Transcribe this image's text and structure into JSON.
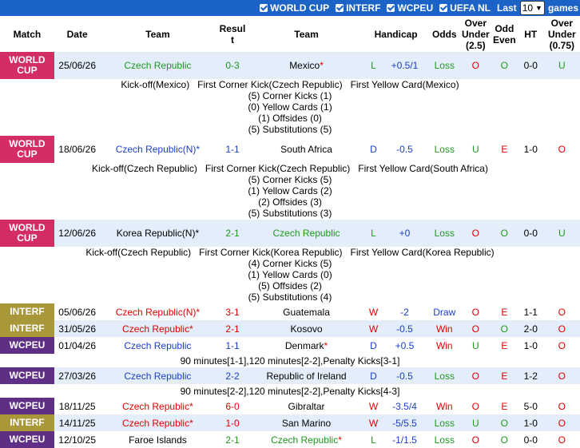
{
  "filters": [
    {
      "label": "WORLD CUP",
      "checked": true
    },
    {
      "label": "INTERF",
      "checked": true
    },
    {
      "label": "WCPEU",
      "checked": true
    },
    {
      "label": "UEFA NL",
      "checked": true
    }
  ],
  "last_label": "Last",
  "last_value": "10",
  "games_label": "games",
  "headers": {
    "match": "Match",
    "date": "Date",
    "team1": "Team",
    "result": "Result",
    "team2": "Team",
    "handicap": "Handicap",
    "odds": "Odds",
    "ou25": "Over Under (2.5)",
    "oddeven": "Odd Even",
    "ht": "HT",
    "ou075": "Over Under (0.75)"
  },
  "rows": [
    {
      "comp": "WORLD CUP",
      "date": "25/06/26",
      "home": "Czech Republic",
      "home_flag": "",
      "away": "Mexico",
      "away_flag": "*",
      "result": "0-3",
      "res": "L",
      "handicap": "+0.5/1",
      "odds": "Loss",
      "ou": "O",
      "oe": "O",
      "ht": "0-0",
      "ou2": "U",
      "details": [
        "Kick-off(Mexico)   First Corner Kick(Czech Republic)   First Yellow Card(Mexico)",
        "(5) Corner Kicks (1)",
        "(0) Yellow Cards (1)",
        "(1) Offsides (0)",
        "(5) Substitutions (5)"
      ]
    },
    {
      "comp": "WORLD CUP",
      "date": "18/06/26",
      "home": "Czech Republic",
      "home_flag": "(N)*",
      "away": "South Africa",
      "away_flag": "",
      "result": "1-1",
      "res": "D",
      "handicap": "-0.5",
      "odds": "Loss",
      "ou": "U",
      "oe": "E",
      "ht": "1-0",
      "ou2": "O",
      "details": [
        "Kick-off(Czech Republic)   First Corner Kick(Czech Republic)   First Yellow Card(South Africa)",
        "(5) Corner Kicks (5)",
        "(1) Yellow Cards (2)",
        "(2) Offsides (3)",
        "(5) Substitutions (3)"
      ]
    },
    {
      "comp": "WORLD CUP",
      "date": "12/06/26",
      "home": "Korea Republic",
      "home_flag": "(N)*",
      "away": "Czech Republic",
      "away_flag": "",
      "result": "2-1",
      "res": "L",
      "handicap": "+0",
      "odds": "Loss",
      "ou": "O",
      "oe": "O",
      "ht": "0-0",
      "ou2": "U",
      "details": [
        "Kick-off(Czech Republic)   First Corner Kick(Korea Republic)   First Yellow Card(Korea Republic)",
        "(4) Corner Kicks (5)",
        "(1) Yellow Cards (0)",
        "(5) Offsides (2)",
        "(5) Substitutions (4)"
      ]
    },
    {
      "comp": "INTERF",
      "date": "05/06/26",
      "home": "Czech Republic",
      "home_flag": "(N)*",
      "away": "Guatemala",
      "away_flag": "",
      "result": "3-1",
      "res": "W",
      "handicap": "-2",
      "odds": "Draw",
      "ou": "O",
      "oe": "E",
      "ht": "1-1",
      "ou2": "O",
      "details": []
    },
    {
      "comp": "INTERF",
      "date": "31/05/26",
      "home": "Czech Republic",
      "home_flag": "*",
      "away": "Kosovo",
      "away_flag": "",
      "result": "2-1",
      "res": "W",
      "handicap": "-0.5",
      "odds": "Win",
      "ou": "O",
      "oe": "O",
      "ht": "2-0",
      "ou2": "O",
      "details": []
    },
    {
      "comp": "WCPEU",
      "date": "01/04/26",
      "home": "Czech Republic",
      "home_flag": "",
      "away": "Denmark",
      "away_flag": "*",
      "result": "1-1",
      "res": "D",
      "handicap": "+0.5",
      "odds": "Win",
      "ou": "U",
      "oe": "E",
      "ht": "1-0",
      "ou2": "O",
      "details": [],
      "note": "90 minutes[1-1],120 minutes[2-2],Penalty Kicks[3-1]"
    },
    {
      "comp": "WCPEU",
      "date": "27/03/26",
      "home": "Czech Republic",
      "home_flag": "",
      "away": "Republic of Ireland",
      "away_flag": "",
      "result": "2-2",
      "res": "D",
      "handicap": "-0.5",
      "odds": "Loss",
      "ou": "O",
      "oe": "E",
      "ht": "1-2",
      "ou2": "O",
      "details": [],
      "note": "90 minutes[2-2],120 minutes[2-2],Penalty Kicks[4-3]"
    },
    {
      "comp": "WCPEU",
      "date": "18/11/25",
      "home": "Czech Republic",
      "home_flag": "*",
      "away": "Gibraltar",
      "away_flag": "",
      "result": "6-0",
      "res": "W",
      "handicap": "-3.5/4",
      "odds": "Win",
      "ou": "O",
      "oe": "E",
      "ht": "5-0",
      "ou2": "O",
      "details": []
    },
    {
      "comp": "INTERF",
      "date": "14/11/25",
      "home": "Czech Republic",
      "home_flag": "*",
      "away": "San Marino",
      "away_flag": "",
      "result": "1-0",
      "res": "W",
      "handicap": "-5/5.5",
      "odds": "Loss",
      "ou": "U",
      "oe": "O",
      "ht": "1-0",
      "ou2": "O",
      "details": []
    },
    {
      "comp": "WCPEU",
      "date": "12/10/25",
      "home": "Faroe Islands",
      "home_flag": "",
      "away": "Czech Republic",
      "away_flag": "*",
      "result": "2-1",
      "res": "L",
      "handicap": "-1/1.5",
      "odds": "Loss",
      "ou": "O",
      "oe": "O",
      "ht": "0-0",
      "ou2": "O",
      "details": []
    }
  ]
}
